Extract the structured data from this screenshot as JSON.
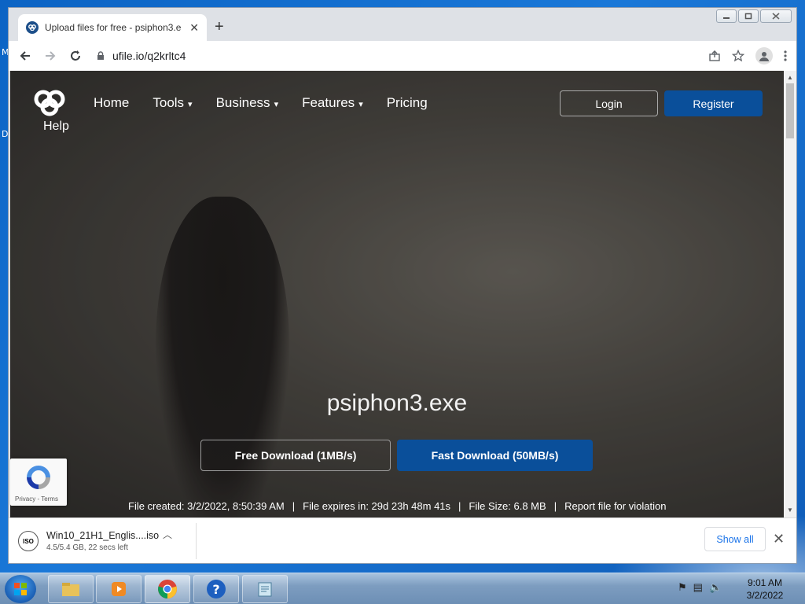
{
  "desktop": {
    "icon_labels": [
      "M",
      "D"
    ]
  },
  "browser": {
    "tab": {
      "title": "Upload files for free - psiphon3.e",
      "close": "✕"
    },
    "new_tab": "+",
    "address": "ufile.io/q2krltc4",
    "window_controls": [
      "minimize",
      "restore",
      "close"
    ]
  },
  "site": {
    "help_label": "Help",
    "nav": [
      {
        "label": "Home",
        "dropdown": false
      },
      {
        "label": "Tools",
        "dropdown": true
      },
      {
        "label": "Business",
        "dropdown": true
      },
      {
        "label": "Features",
        "dropdown": true
      },
      {
        "label": "Pricing",
        "dropdown": false
      }
    ],
    "login": "Login",
    "register": "Register",
    "filename": "psiphon3.exe",
    "free_download": "Free Download (1MB/s)",
    "fast_download": "Fast Download (50MB/s)",
    "file_created": "File created: 3/2/2022, 8:50:39 AM",
    "file_expires": "File expires in: 29d 23h 48m 41s",
    "file_size": "File Size: 6.8 MB",
    "report": "Report file for violation",
    "separator": "|",
    "recaptcha_links": "Privacy - Terms",
    "colors": {
      "brand_blue": "#0a4f9a"
    }
  },
  "download_shelf": {
    "file": "Win10_21H1_Englis....iso",
    "status": "4.5/5.4 GB, 22 secs left",
    "show_all": "Show all",
    "icon_text": "ISO"
  },
  "taskbar": {
    "apps": [
      "explorer-icon",
      "media-player-icon",
      "chrome-icon",
      "help-icon",
      "notepad-icon"
    ],
    "time": "9:01 AM",
    "date": "3/2/2022"
  }
}
